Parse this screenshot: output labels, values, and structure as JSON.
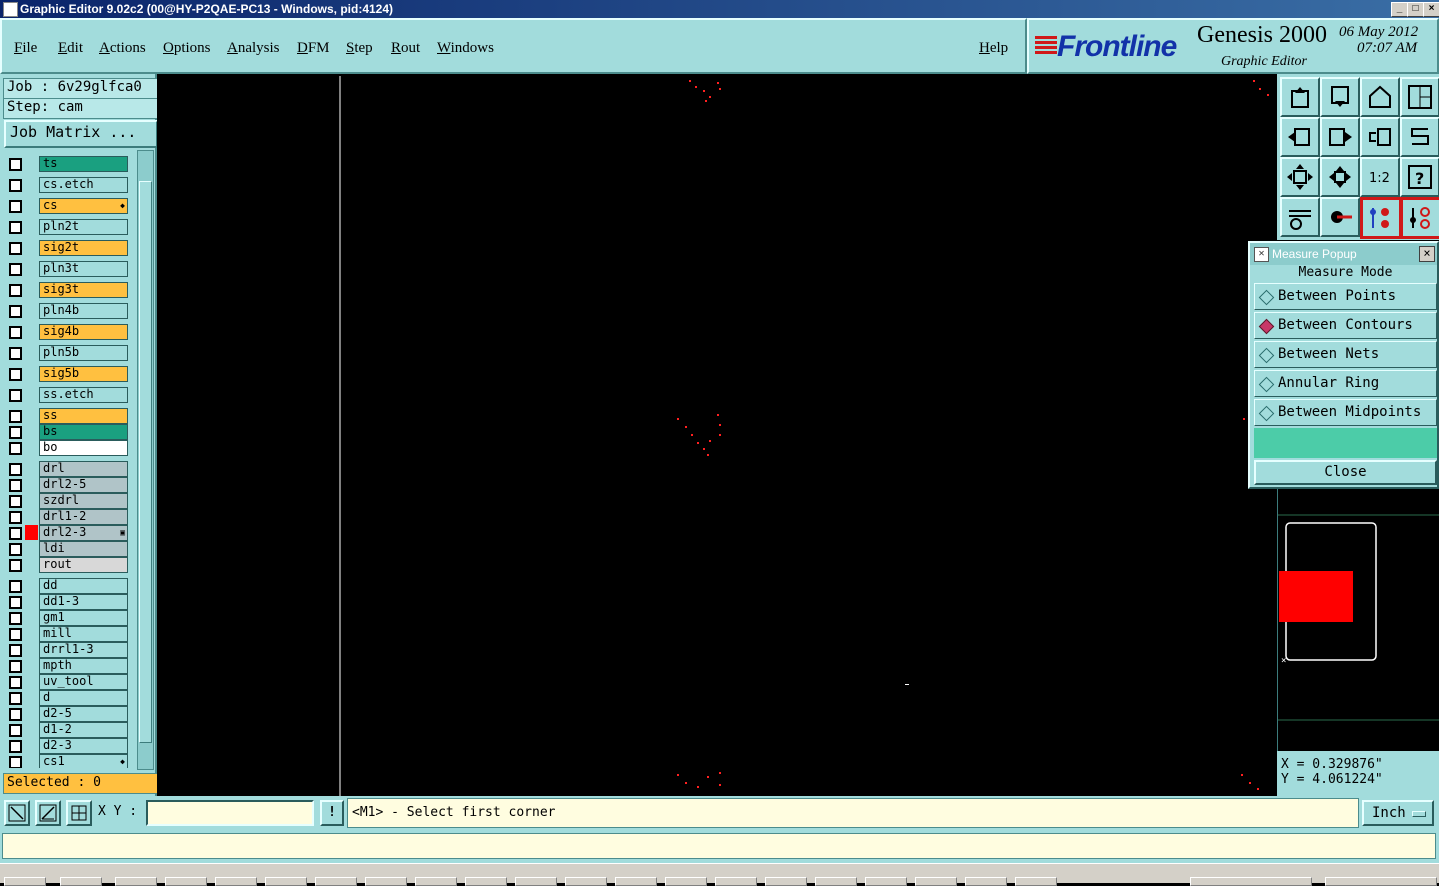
{
  "window": {
    "title": "Graphic Editor 9.02c2 (00@HY-P2QAE-PC13 - Windows, pid:4124)",
    "controls": [
      "_",
      "□",
      "×"
    ]
  },
  "menu": [
    "File",
    "Edit",
    "Actions",
    "Options",
    "Analysis",
    "DFM",
    "Step",
    "Rout",
    "Windows"
  ],
  "help_label": "Help",
  "brand": {
    "logo": "Frontline",
    "product": "Genesis 2000",
    "subtitle": "Graphic Editor",
    "date": "06 May 2012",
    "time": "07:07 AM"
  },
  "job": {
    "job_line": "Job : 6v29glfca0",
    "step_line": "Step: cam",
    "matrix_button": "Job Matrix ..."
  },
  "layers": [
    {
      "name": "ts",
      "color": "#1aa080"
    },
    {
      "name": "cs.etch",
      "color": "#a2dcdc"
    },
    {
      "name": "cs",
      "color": "#ffc040",
      "work": true
    },
    {
      "name": "pln2t",
      "color": "#a2dcdc"
    },
    {
      "name": "sig2t",
      "color": "#ffc040"
    },
    {
      "name": "pln3t",
      "color": "#a2dcdc"
    },
    {
      "name": "sig3t",
      "color": "#ffc040"
    },
    {
      "name": "pln4b",
      "color": "#a2dcdc"
    },
    {
      "name": "sig4b",
      "color": "#ffc040"
    },
    {
      "name": "pln5b",
      "color": "#a2dcdc"
    },
    {
      "name": "sig5b",
      "color": "#ffc040"
    },
    {
      "name": "ss.etch",
      "color": "#a2dcdc"
    },
    {
      "name": "ss",
      "color": "#ffc040"
    },
    {
      "name": "bs",
      "color": "#1aa080"
    },
    {
      "name": "bo",
      "color": "#ffffff"
    },
    {
      "name": "drl",
      "color": "#b0c4c8"
    },
    {
      "name": "drl2-5",
      "color": "#b0c4c8"
    },
    {
      "name": "szdrl",
      "color": "#b0c4c8"
    },
    {
      "name": "drl1-2",
      "color": "#b0c4c8"
    },
    {
      "name": "drl2-3",
      "color": "#b0c4c8",
      "active": true
    },
    {
      "name": "ldi",
      "color": "#b0c4c8"
    },
    {
      "name": "rout",
      "color": "#d8d8d8"
    },
    {
      "name": "dd",
      "color": "#a2dcdc"
    },
    {
      "name": "dd1-3",
      "color": "#a2dcdc"
    },
    {
      "name": "gm1",
      "color": "#a2dcdc"
    },
    {
      "name": "mill",
      "color": "#a2dcdc"
    },
    {
      "name": "drrl1-3",
      "color": "#a2dcdc"
    },
    {
      "name": "mpth",
      "color": "#a2dcdc"
    },
    {
      "name": "uv_tool",
      "color": "#a2dcdc"
    },
    {
      "name": "d",
      "color": "#a2dcdc"
    },
    {
      "name": "d2-5",
      "color": "#a2dcdc"
    },
    {
      "name": "d1-2",
      "color": "#a2dcdc"
    },
    {
      "name": "d2-3",
      "color": "#a2dcdc"
    },
    {
      "name": "cs1",
      "color": "#a2dcdc",
      "work": true
    }
  ],
  "selected_label": "Selected : 0",
  "measure": {
    "title": "Measure Popup",
    "mode_label": "Measure Mode",
    "options": [
      {
        "label": "Between Points",
        "selected": false
      },
      {
        "label": "Between Contours",
        "selected": true
      },
      {
        "label": "Between Nets",
        "selected": false
      },
      {
        "label": "Annular Ring",
        "selected": false
      },
      {
        "label": "Between Midpoints",
        "selected": false
      }
    ],
    "close_label": "Close"
  },
  "toolbar_icons": [
    "zoom-top-icon",
    "zoom-down-icon",
    "home-icon",
    "split-view-icon",
    "pan-left-icon",
    "pan-right-icon",
    "undo-view-icon",
    "redraw-icon",
    "fit-icon",
    "center-icon",
    "scale-1-2-icon",
    "help-icon",
    "settings-icon",
    "measure-icon",
    "snap-icon",
    "drc-icon"
  ],
  "toolbar_scale_label": "1:2",
  "coords": {
    "x": "X = 0.329876\"",
    "y": "Y = 4.061224\""
  },
  "command": {
    "xy_label": "X Y :",
    "xy_value": "",
    "bang_label": "!",
    "prompt": "<M1> - Select first corner",
    "unit": "Inch"
  },
  "colors": {
    "panel": "#a2dcdc",
    "canvas": "#000000",
    "highlight": "#ffc040",
    "feature": "#ff0000"
  }
}
